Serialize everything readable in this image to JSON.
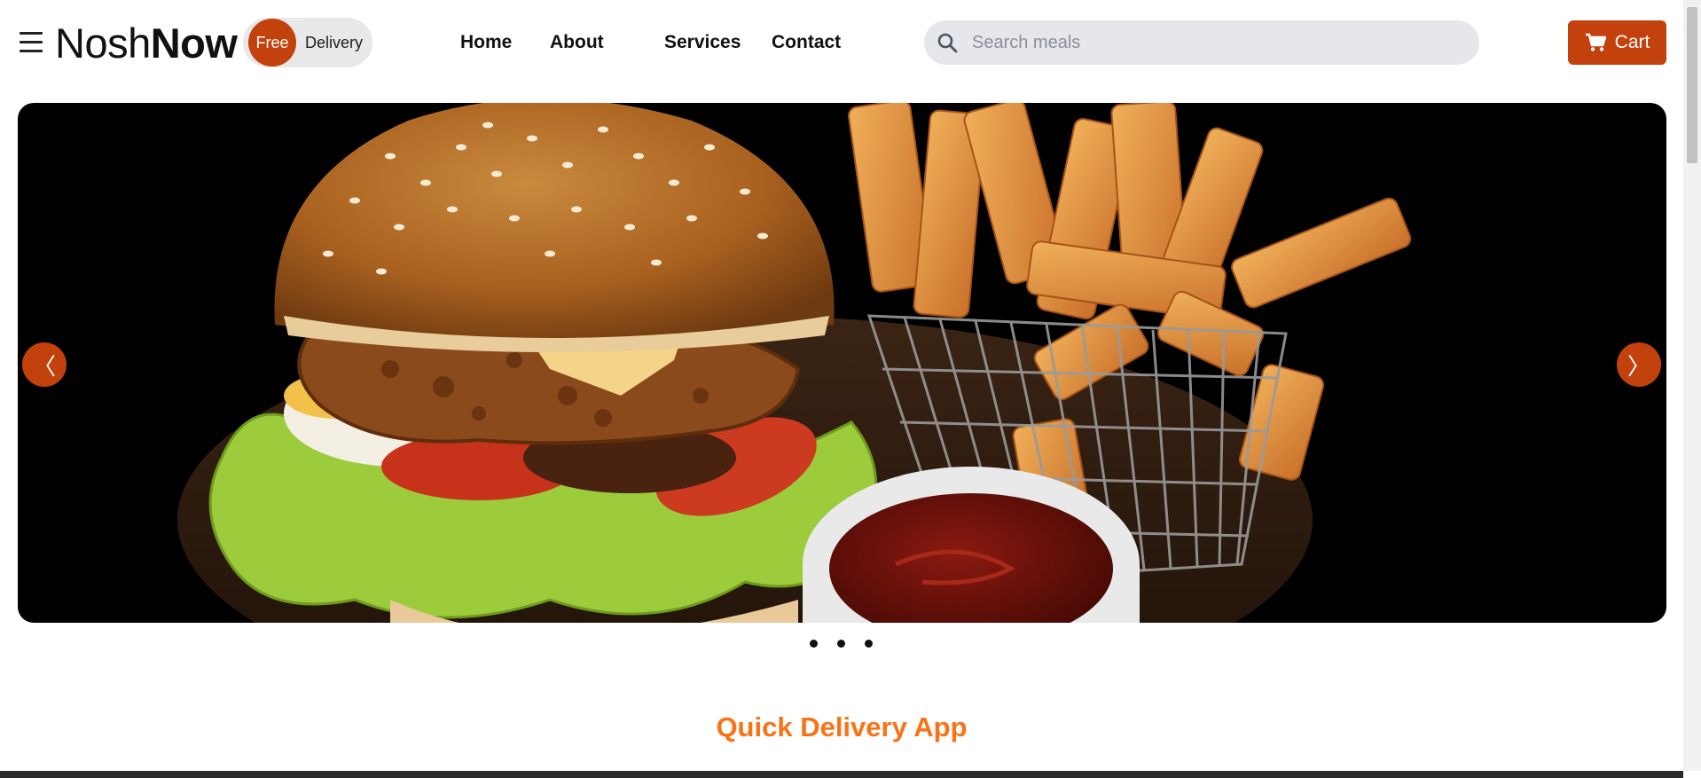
{
  "brand": {
    "name_light": "Nosh",
    "name_bold": "Now",
    "badge_circle": "Free",
    "badge_text": "Delivery",
    "accent_color": "#c2410c"
  },
  "nav": {
    "home": "Home",
    "about": "About",
    "services": "Services",
    "contact": "Contact"
  },
  "search": {
    "placeholder": "Search meals",
    "icon": "search-icon"
  },
  "cart": {
    "label": "Cart",
    "icon": "cart-icon"
  },
  "hero": {
    "prev_arrow": "〈",
    "next_arrow": "〉",
    "dot_count": 3,
    "image_subject": "burger-and-fries"
  },
  "section": {
    "title": "Quick Delivery App",
    "title_color": "#f97316"
  }
}
